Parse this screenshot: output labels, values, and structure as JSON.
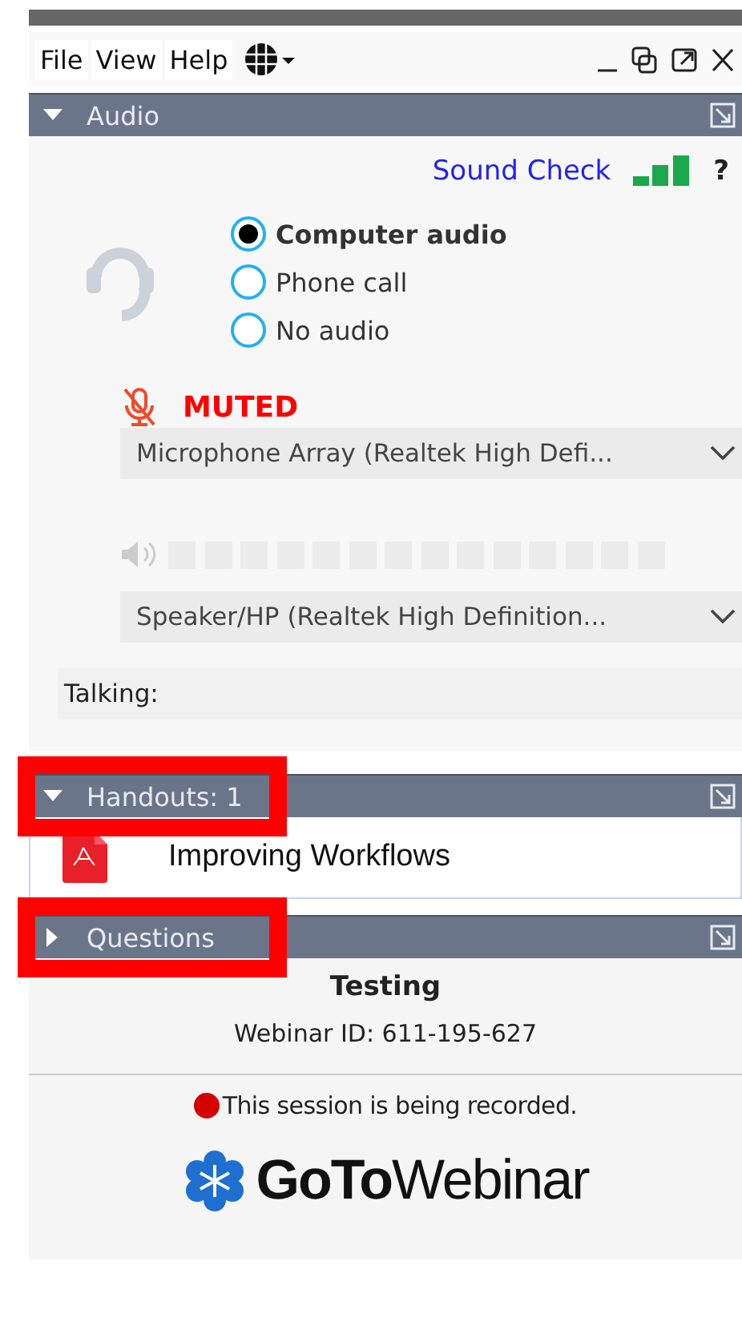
{
  "menu": [
    {
      "label": "File"
    },
    {
      "label": "View"
    },
    {
      "label": "Help"
    }
  ],
  "audio": {
    "title": "Audio",
    "expanded": true,
    "highlighted": false,
    "sound_check": "Sound Check",
    "help": "?",
    "options": [
      {
        "label": "Computer audio",
        "selected": true
      },
      {
        "label": "Phone call",
        "selected": false
      },
      {
        "label": "No audio",
        "selected": false
      }
    ],
    "muted": true,
    "mic_status": "MUTED",
    "microphone": "Microphone Array (Realtek High Defi...",
    "speaker": "Speaker/HP (Realtek High Definition...",
    "talking": "Talking:"
  },
  "handouts": {
    "title": "Handouts: 1",
    "expanded": true,
    "highlighted": true,
    "items": [
      {
        "name": "Improving Workflows"
      }
    ]
  },
  "questions": {
    "title": "Questions",
    "expanded": false,
    "highlighted": true
  },
  "session": {
    "title": "Testing",
    "webinar_id": "Webinar ID: 611-195-627",
    "recording": "This session is being recorded.",
    "logo": "**GoTo**Webinar"
  }
}
